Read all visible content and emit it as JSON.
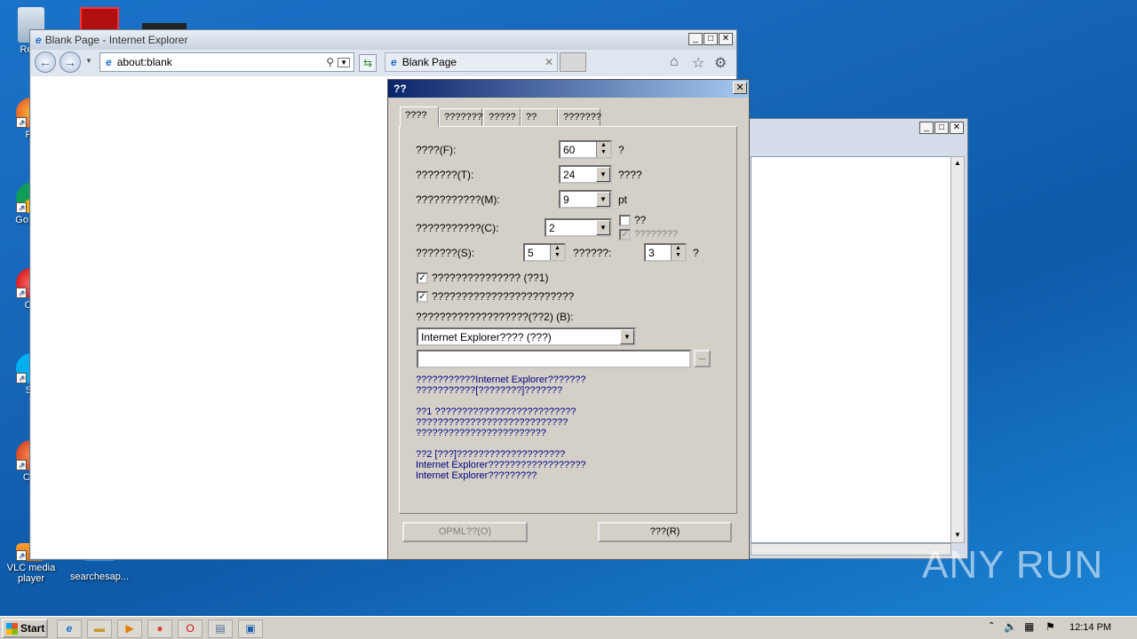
{
  "desktop": {
    "icons": [
      {
        "label": "Recy"
      },
      {
        "label": "Fir"
      },
      {
        "label": "Go Chr"
      },
      {
        "label": "Op"
      },
      {
        "label": "Sk"
      },
      {
        "label": "CCl"
      },
      {
        "label": "VLC media player"
      },
      {
        "label": "searchesap..."
      }
    ]
  },
  "ie_window": {
    "title": "Blank Page - Internet Explorer",
    "address": "about:blank",
    "tab_label": "Blank Page",
    "tab_close": "✕"
  },
  "bg_window": {},
  "dialog": {
    "title": "??",
    "close": "✕",
    "tabs": [
      "????",
      "????????",
      "?????",
      "??",
      "???????"
    ],
    "rows": {
      "interval_label": "????(F):",
      "interval_value": "60",
      "interval_unit": "?",
      "keep_label": "???????(T):",
      "keep_value": "24",
      "keep_unit": "????",
      "font_label": "???????????(M):",
      "font_value": "9",
      "font_unit": "pt",
      "cols_label": "???????????(C):",
      "cols_value": "2",
      "chk_a_label": "??",
      "chk_b_label": "????????",
      "speed_label": "???????(S):",
      "speed_value": "5",
      "speed2_label": "??????:",
      "speed2_value": "3",
      "speed2_unit": "?",
      "opt1_label": "??????????????? (??1)",
      "opt2_label": "????????????????????????",
      "browser_label": "???????????????????(??2) (B):",
      "browser_value": "Internet Explorer???? (???)",
      "path_value": "",
      "browse_btn": "..."
    },
    "info1": "???????????Internet Explorer???????\n???????????[????????]???????",
    "info2": "??1 ??????????????????????????\n????????????????????????????\n????????????????????????",
    "info3": "??2 [???]????????????????????\nInternet Explorer??????????????????\nInternet Explorer?????????",
    "opml_btn": "OPML??(O)",
    "reset_btn": "???(R)"
  },
  "taskbar": {
    "start": "Start",
    "clock": "12:14 PM"
  },
  "watermark": "ANY RUN"
}
